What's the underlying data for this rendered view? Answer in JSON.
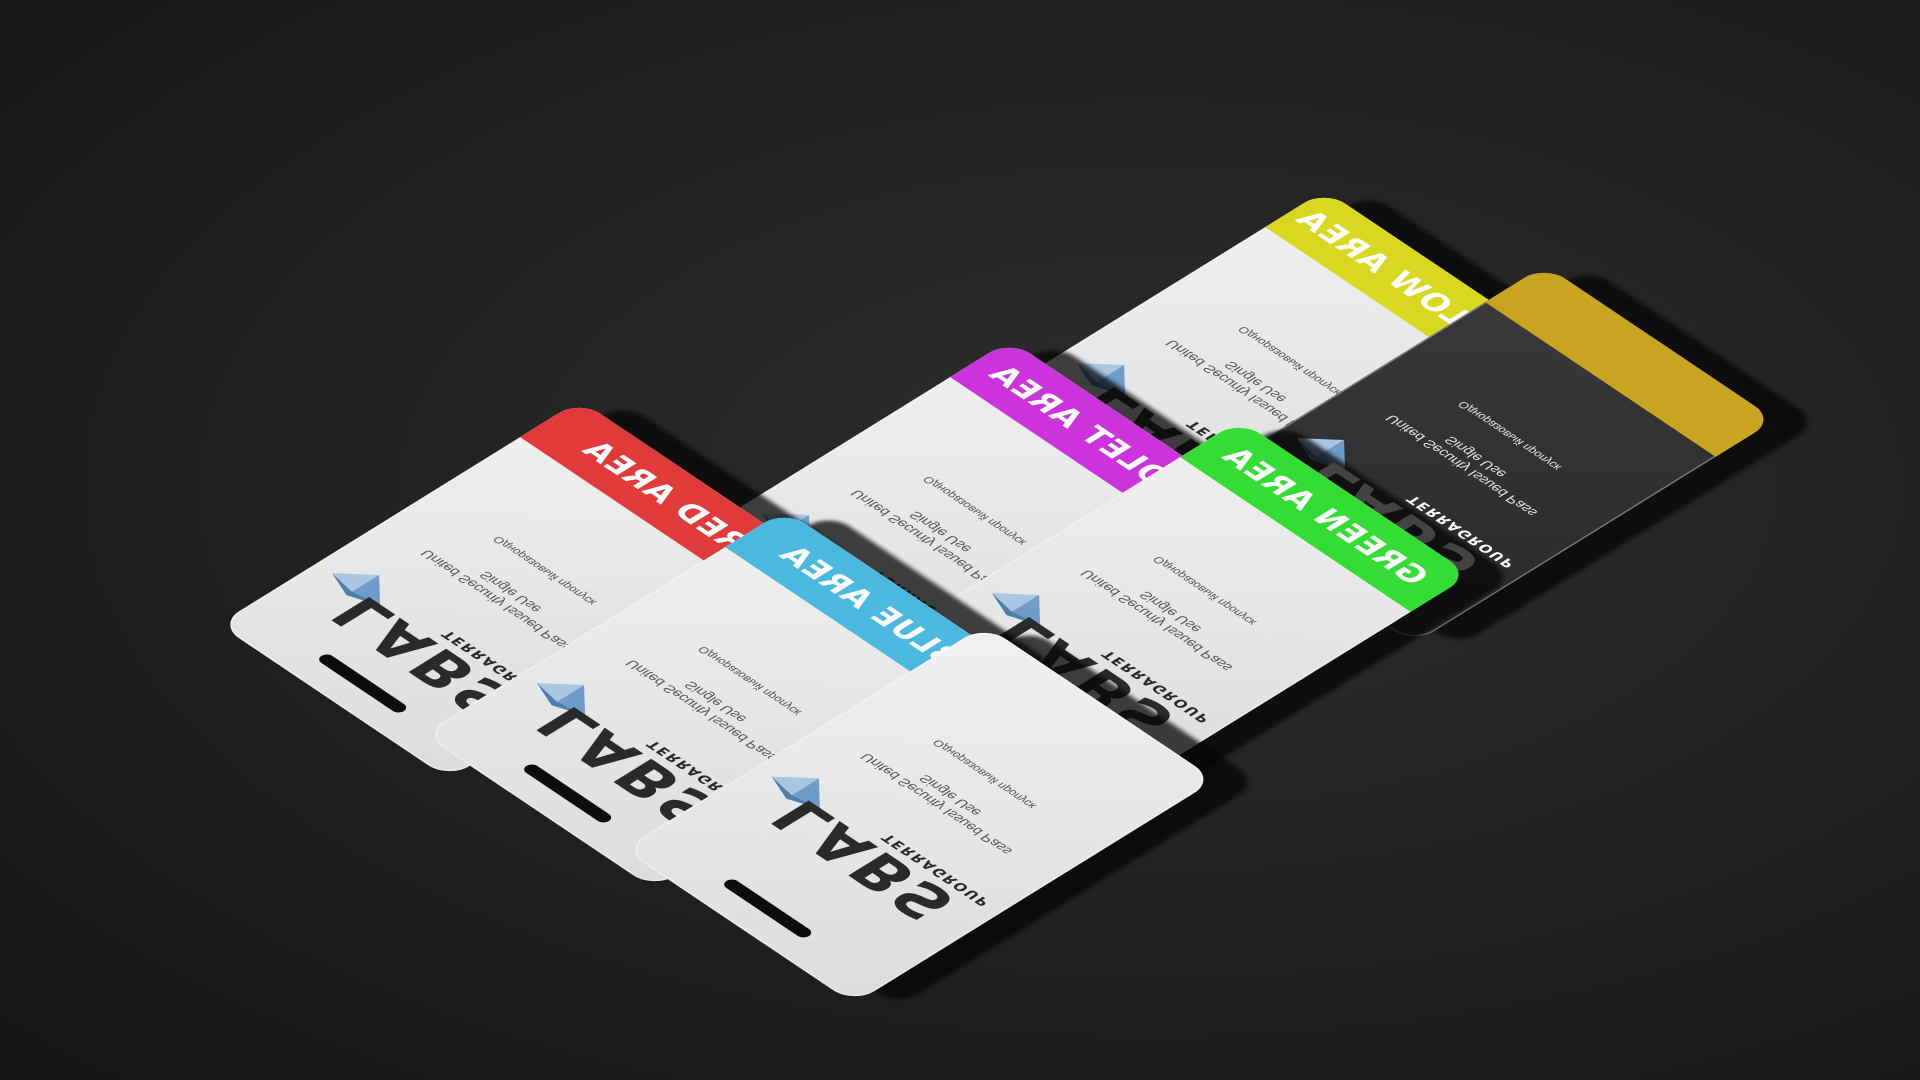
{
  "scene": {
    "description_free": true
  },
  "cards": [
    {
      "key": "red",
      "band_label": "RED AREA",
      "band_color": "#e03a3a",
      "label_dark": false,
      "logo_text": "LABS",
      "logo_sub": "TERRAGROUP",
      "line1": "United Security Issued Pass",
      "line2": "Single Use",
      "line3": "Одноразовый пропуск",
      "dark": false
    },
    {
      "key": "blue",
      "band_label": "BLUE AREA",
      "band_color": "#4bb8e0",
      "label_dark": false,
      "logo_text": "LABS",
      "logo_sub": "TERRAGROUP",
      "line1": "United Security Issued Pass",
      "line2": "Single Use",
      "line3": "Одноразовый пропуск",
      "dark": false
    },
    {
      "key": "plain",
      "band_label": "",
      "band_color": "",
      "label_dark": false,
      "logo_text": "LABS",
      "logo_sub": "TERRAGROUP",
      "line1": "United Security Issued Pass",
      "line2": "Single Use",
      "line3": "Одноразовый пропуск",
      "dark": false
    },
    {
      "key": "violet",
      "band_label": "VIOLET AREA",
      "band_color": "#cc33dd",
      "label_dark": false,
      "logo_text": "LABS",
      "logo_sub": "TERRAGROUP",
      "line1": "United Security Issued Pass",
      "line2": "Single Use",
      "line3": "Одноразовый пропуск",
      "dark": false
    },
    {
      "key": "green",
      "band_label": "GREEN AREA",
      "band_color": "#33dd33",
      "label_dark": false,
      "logo_text": "LABS",
      "logo_sub": "TERRAGROUP",
      "line1": "United Security Issued Pass",
      "line2": "Single Use",
      "line3": "Одноразовый пропуск",
      "dark": false
    },
    {
      "key": "yellow",
      "band_label": "YELLOW AREA",
      "band_color": "#d8d820",
      "label_dark": false,
      "logo_text": "LABS",
      "logo_sub": "TERRAGROUP",
      "line1": "United Security Issued Pass",
      "line2": "Single Use",
      "line3": "Одноразовый пропуск",
      "dark": false
    },
    {
      "key": "black",
      "band_label": "",
      "band_color": "#c8a420",
      "label_dark": false,
      "logo_text": "LABS",
      "logo_sub": "TERRAGROUP",
      "line1": "United Security Issued Pass",
      "line2": "Single Use",
      "line3": "Одноразовый пропуск",
      "dark": true
    }
  ],
  "colors": {
    "logo_light": "#a9c6e2",
    "logo_mid": "#6f9cc8",
    "logo_dark": "#4f7fae"
  }
}
